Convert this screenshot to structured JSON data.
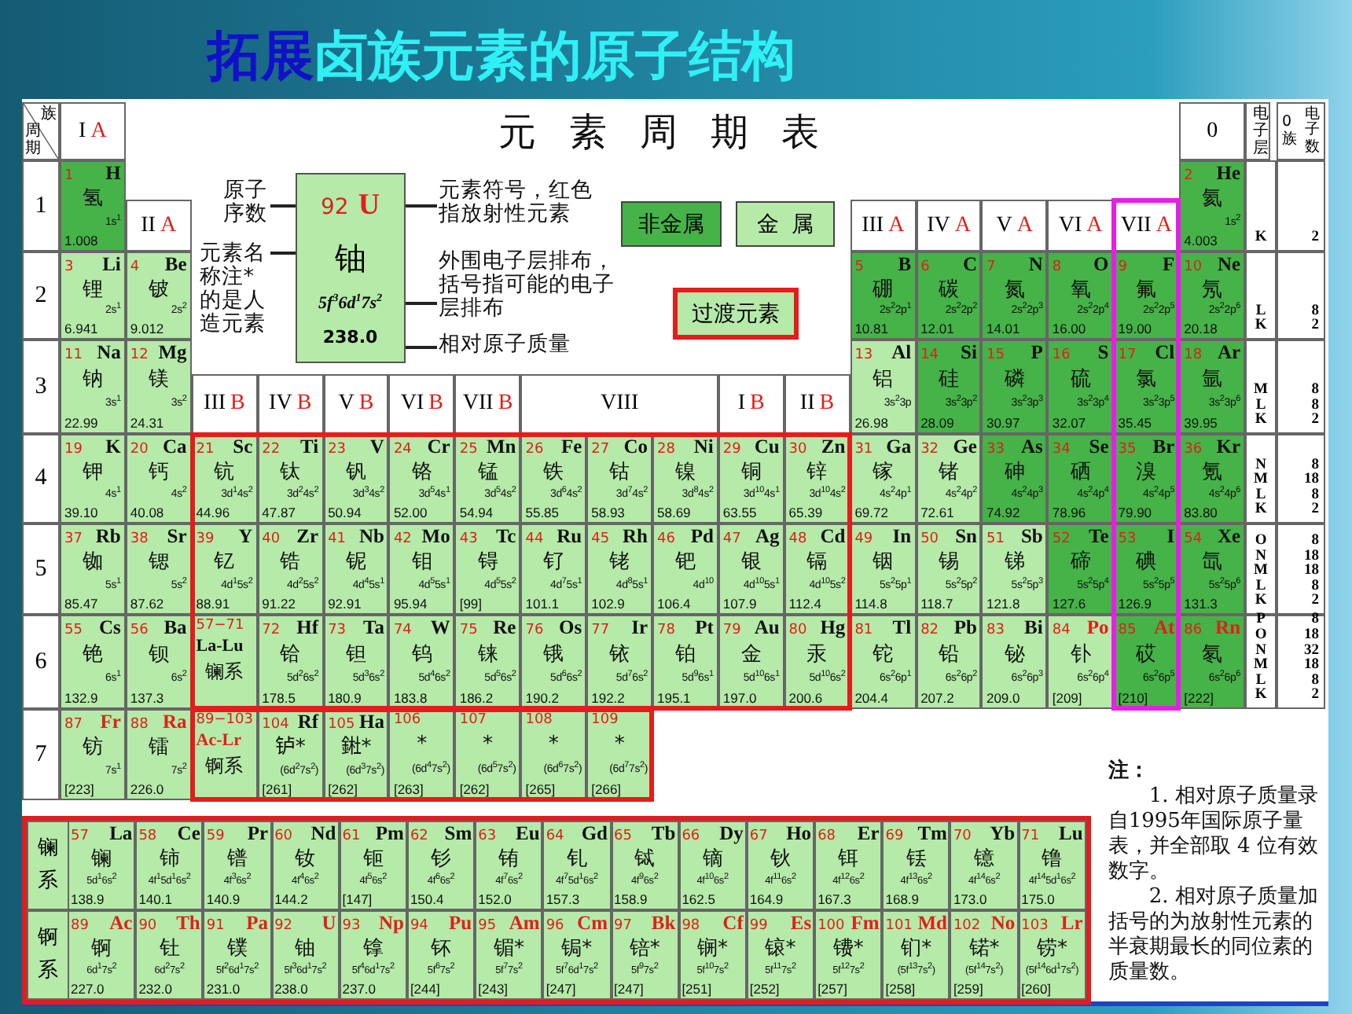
{
  "slide_title": {
    "lead": "拓展",
    "text": "卤族元素的原子结构"
  },
  "table_title": "元素周期表",
  "corner": {
    "group_axis": "族",
    "period_axis": "周期"
  },
  "headers": {
    "ia": {
      "numeral": "I",
      "suffix": "A"
    },
    "zero": {
      "numeral": "0"
    },
    "iia": {
      "numeral": "II",
      "suffix": "A"
    },
    "a_groups": [
      {
        "numeral": "III",
        "suffix": "A"
      },
      {
        "numeral": "IV",
        "suffix": "A"
      },
      {
        "numeral": "V",
        "suffix": "A"
      },
      {
        "numeral": "VI",
        "suffix": "A"
      },
      {
        "numeral": "VII",
        "suffix": "A"
      }
    ],
    "b_groups": [
      {
        "numeral": "III",
        "suffix": "B"
      },
      {
        "numeral": "IV",
        "suffix": "B"
      },
      {
        "numeral": "V",
        "suffix": "B"
      },
      {
        "numeral": "VI",
        "suffix": "B"
      },
      {
        "numeral": "VII",
        "suffix": "B"
      },
      {
        "numeral": "VIII"
      },
      {
        "numeral": "I",
        "suffix": "B"
      },
      {
        "numeral": "II",
        "suffix": "B"
      }
    ]
  },
  "legend": {
    "atomic_number_label": "原子序数",
    "name_label": "元素名称注*的是人造元素",
    "sample": {
      "n": "92",
      "sym": "U",
      "name": "铀",
      "cfg": "5f$^{3}$6d$^{1}$7s$^{2}$",
      "mass": "238.0",
      "radioactive": true
    },
    "symbol_label": "元素符号，红色指放射性元素",
    "config_label": "外围电子层排布，括号指可能的电子层排布",
    "mass_label": "相对原子质量",
    "categories": [
      {
        "label": "非金属",
        "nonmetal": true
      },
      {
        "label": "金属",
        "nonmetal": false
      }
    ],
    "transition_label": "过渡元素"
  },
  "shells": {
    "layer_header": "电子层",
    "count_header": [
      "0族",
      "电子数"
    ],
    "rows": [
      {
        "layers": [
          "K"
        ],
        "counts": [
          "2"
        ]
      },
      {
        "layers": [
          "L",
          "K"
        ],
        "counts": [
          "8",
          "2"
        ]
      },
      {
        "layers": [
          "M",
          "L",
          "K"
        ],
        "counts": [
          "8",
          "8",
          "2"
        ]
      },
      {
        "layers": [
          "N",
          "M",
          "L",
          "K"
        ],
        "counts": [
          "8",
          "18",
          "8",
          "2"
        ]
      },
      {
        "layers": [
          "O",
          "N",
          "M",
          "L",
          "K"
        ],
        "counts": [
          "8",
          "18",
          "18",
          "8",
          "2"
        ]
      },
      {
        "layers": [
          "P",
          "O",
          "N",
          "M",
          "L",
          "K"
        ],
        "counts": [
          "8",
          "18",
          "32",
          "18",
          "8",
          "2"
        ]
      }
    ]
  },
  "periods": [
    {
      "label": "1",
      "cells": [
        {
          "kind": "element",
          "n": "1",
          "sym": "H",
          "name": "氢",
          "cfg": "1s$^{1}$",
          "mass": "1.008",
          "nonmetal": true,
          "radioactive": false
        },
        {
          "kind": "element",
          "n": "2",
          "sym": "He",
          "name": "氦",
          "cfg": "1s$^{2}$",
          "mass": "4.003",
          "nonmetal": true,
          "radioactive": false
        }
      ]
    },
    {
      "label": "2",
      "cells": [
        {
          "kind": "element",
          "n": "3",
          "sym": "Li",
          "name": "锂",
          "cfg": "2s$^{1}$",
          "mass": "6.941",
          "nonmetal": false,
          "radioactive": false
        },
        {
          "kind": "element",
          "n": "4",
          "sym": "Be",
          "name": "铍",
          "cfg": "2s$^{2}$",
          "mass": "9.012",
          "nonmetal": false,
          "radioactive": false
        },
        {
          "kind": "element",
          "n": "5",
          "sym": "B",
          "name": "硼",
          "cfg": "2s$^{2}$2p$^{1}$",
          "mass": "10.81",
          "nonmetal": true,
          "radioactive": false
        },
        {
          "kind": "element",
          "n": "6",
          "sym": "C",
          "name": "碳",
          "cfg": "2s$^{2}$2p$^{2}$",
          "mass": "12.01",
          "nonmetal": true,
          "radioactive": false
        },
        {
          "kind": "element",
          "n": "7",
          "sym": "N",
          "name": "氮",
          "cfg": "2s$^{2}$2p$^{3}$",
          "mass": "14.01",
          "nonmetal": true,
          "radioactive": false
        },
        {
          "kind": "element",
          "n": "8",
          "sym": "O",
          "name": "氧",
          "cfg": "2s$^{2}$2p$^{4}$",
          "mass": "16.00",
          "nonmetal": true,
          "radioactive": false
        },
        {
          "kind": "element",
          "n": "9",
          "sym": "F",
          "name": "氟",
          "cfg": "2s$^{2}$2p$^{5}$",
          "mass": "19.00",
          "nonmetal": true,
          "radioactive": false
        },
        {
          "kind": "element",
          "n": "10",
          "sym": "Ne",
          "name": "氖",
          "cfg": "2s$^{2}$2p$^{6}$",
          "mass": "20.18",
          "nonmetal": true,
          "radioactive": false
        }
      ]
    },
    {
      "label": "3",
      "cells": [
        {
          "kind": "element",
          "n": "11",
          "sym": "Na",
          "name": "钠",
          "cfg": "3s$^{1}$",
          "mass": "22.99",
          "nonmetal": false,
          "radioactive": false
        },
        {
          "kind": "element",
          "n": "12",
          "sym": "Mg",
          "name": "镁",
          "cfg": "3s$^{2}$",
          "mass": "24.31",
          "nonmetal": false,
          "radioactive": false
        },
        {
          "kind": "element",
          "n": "13",
          "sym": "Al",
          "name": "铝",
          "cfg": "3s$^{2}$3p",
          "mass": "26.98",
          "nonmetal": false,
          "radioactive": false
        },
        {
          "kind": "element",
          "n": "14",
          "sym": "Si",
          "name": "硅",
          "cfg": "3s$^{2}$3p$^{2}$",
          "mass": "28.09",
          "nonmetal": true,
          "radioactive": false
        },
        {
          "kind": "element",
          "n": "15",
          "sym": "P",
          "name": "磷",
          "cfg": "3s$^{2}$3p$^{3}$",
          "mass": "30.97",
          "nonmetal": true,
          "radioactive": false
        },
        {
          "kind": "element",
          "n": "16",
          "sym": "S",
          "name": "硫",
          "cfg": "3s$^{2}$3p$^{4}$",
          "mass": "32.07",
          "nonmetal": true,
          "radioactive": false
        },
        {
          "kind": "element",
          "n": "17",
          "sym": "Cl",
          "name": "氯",
          "cfg": "3s$^{2}$3p$^{5}$",
          "mass": "35.45",
          "nonmetal": true,
          "radioactive": false
        },
        {
          "kind": "element",
          "n": "18",
          "sym": "Ar",
          "name": "氩",
          "cfg": "3s$^{2}$3p$^{6}$",
          "mass": "39.95",
          "nonmetal": true,
          "radioactive": false
        }
      ]
    },
    {
      "label": "4",
      "cells": [
        {
          "kind": "element",
          "n": "19",
          "sym": "K",
          "name": "钾",
          "cfg": "4s$^{1}$",
          "mass": "39.10",
          "nonmetal": false,
          "radioactive": false
        },
        {
          "kind": "element",
          "n": "20",
          "sym": "Ca",
          "name": "钙",
          "cfg": "4s$^{2}$",
          "mass": "40.08",
          "nonmetal": false,
          "radioactive": false
        },
        {
          "kind": "element",
          "n": "21",
          "sym": "Sc",
          "name": "钪",
          "cfg": "3d$^{1}$4s$^{2}$",
          "mass": "44.96",
          "nonmetal": false,
          "radioactive": false
        },
        {
          "kind": "element",
          "n": "22",
          "sym": "Ti",
          "name": "钛",
          "cfg": "3d$^{2}$4s$^{2}$",
          "mass": "47.87",
          "nonmetal": false,
          "radioactive": false
        },
        {
          "kind": "element",
          "n": "23",
          "sym": "V",
          "name": "钒",
          "cfg": "3d$^{3}$4s$^{2}$",
          "mass": "50.94",
          "nonmetal": false,
          "radioactive": false
        },
        {
          "kind": "element",
          "n": "24",
          "sym": "Cr",
          "name": "铬",
          "cfg": "3d$^{5}$4s$^{1}$",
          "mass": "52.00",
          "nonmetal": false,
          "radioactive": false
        },
        {
          "kind": "element",
          "n": "25",
          "sym": "Mn",
          "name": "锰",
          "cfg": "3d$^{5}$4s$^{2}$",
          "mass": "54.94",
          "nonmetal": false,
          "radioactive": false
        },
        {
          "kind": "element",
          "n": "26",
          "sym": "Fe",
          "name": "铁",
          "cfg": "3d$^{6}$4s$^{2}$",
          "mass": "55.85",
          "nonmetal": false,
          "radioactive": false
        },
        {
          "kind": "element",
          "n": "27",
          "sym": "Co",
          "name": "钴",
          "cfg": "3d$^{7}$4s$^{2}$",
          "mass": "58.93",
          "nonmetal": false,
          "radioactive": false
        },
        {
          "kind": "element",
          "n": "28",
          "sym": "Ni",
          "name": "镍",
          "cfg": "3d$^{8}$4s$^{2}$",
          "mass": "58.69",
          "nonmetal": false,
          "radioactive": false
        },
        {
          "kind": "element",
          "n": "29",
          "sym": "Cu",
          "name": "铜",
          "cfg": "3d$^{10}$4s$^{1}$",
          "mass": "63.55",
          "nonmetal": false,
          "radioactive": false
        },
        {
          "kind": "element",
          "n": "30",
          "sym": "Zn",
          "name": "锌",
          "cfg": "3d$^{10}$4s$^{2}$",
          "mass": "65.39",
          "nonmetal": false,
          "radioactive": false
        },
        {
          "kind": "element",
          "n": "31",
          "sym": "Ga",
          "name": "镓",
          "cfg": "4s$^{2}$4p$^{1}$",
          "mass": "69.72",
          "nonmetal": false,
          "radioactive": false
        },
        {
          "kind": "element",
          "n": "32",
          "sym": "Ge",
          "name": "锗",
          "cfg": "4s$^{2}$4p$^{2}$",
          "mass": "72.61",
          "nonmetal": false,
          "radioactive": false
        },
        {
          "kind": "element",
          "n": "33",
          "sym": "As",
          "name": "砷",
          "cfg": "4s$^{2}$4p$^{3}$",
          "mass": "74.92",
          "nonmetal": true,
          "radioactive": false
        },
        {
          "kind": "element",
          "n": "34",
          "sym": "Se",
          "name": "硒",
          "cfg": "4s$^{2}$4p$^{4}$",
          "mass": "78.96",
          "nonmetal": true,
          "radioactive": false
        },
        {
          "kind": "element",
          "n": "35",
          "sym": "Br",
          "name": "溴",
          "cfg": "4s$^{2}$4p$^{5}$",
          "mass": "79.90",
          "nonmetal": true,
          "radioactive": false
        },
        {
          "kind": "element",
          "n": "36",
          "sym": "Kr",
          "name": "氪",
          "cfg": "4s$^{2}$4p$^{6}$",
          "mass": "83.80",
          "nonmetal": true,
          "radioactive": false
        }
      ]
    },
    {
      "label": "5",
      "cells": [
        {
          "kind": "element",
          "n": "37",
          "sym": "Rb",
          "name": "铷",
          "cfg": "5s$^{1}$",
          "mass": "85.47",
          "nonmetal": false,
          "radioactive": false
        },
        {
          "kind": "element",
          "n": "38",
          "sym": "Sr",
          "name": "锶",
          "cfg": "5s$^{2}$",
          "mass": "87.62",
          "nonmetal": false,
          "radioactive": false
        },
        {
          "kind": "element",
          "n": "39",
          "sym": "Y",
          "name": "钇",
          "cfg": "4d$^{1}$5s$^{2}$",
          "mass": "88.91",
          "nonmetal": false,
          "radioactive": false
        },
        {
          "kind": "element",
          "n": "40",
          "sym": "Zr",
          "name": "锆",
          "cfg": "4d$^{2}$5s$^{2}$",
          "mass": "91.22",
          "nonmetal": false,
          "radioactive": false
        },
        {
          "kind": "element",
          "n": "41",
          "sym": "Nb",
          "name": "铌",
          "cfg": "4d$^{4}$5s$^{1}$",
          "mass": "92.91",
          "nonmetal": false,
          "radioactive": false
        },
        {
          "kind": "element",
          "n": "42",
          "sym": "Mo",
          "name": "钼",
          "cfg": "4d$^{5}$5s$^{1}$",
          "mass": "95.94",
          "nonmetal": false,
          "radioactive": false
        },
        {
          "kind": "element",
          "n": "43",
          "sym": "Tc",
          "name": "锝",
          "cfg": "4d$^{5}$5s$^{2}$",
          "mass": "[99]",
          "nonmetal": false,
          "radioactive": false
        },
        {
          "kind": "element",
          "n": "44",
          "sym": "Ru",
          "name": "钌",
          "cfg": "4d$^{7}$5s$^{1}$",
          "mass": "101.1",
          "nonmetal": false,
          "radioactive": false
        },
        {
          "kind": "element",
          "n": "45",
          "sym": "Rh",
          "name": "铑",
          "cfg": "4d$^{8}$5s$^{1}$",
          "mass": "102.9",
          "nonmetal": false,
          "radioactive": false
        },
        {
          "kind": "element",
          "n": "46",
          "sym": "Pd",
          "name": "钯",
          "cfg": "4d$^{10}$",
          "mass": "106.4",
          "nonmetal": false,
          "radioactive": false
        },
        {
          "kind": "element",
          "n": "47",
          "sym": "Ag",
          "name": "银",
          "cfg": "4d$^{10}$5s$^{1}$",
          "mass": "107.9",
          "nonmetal": false,
          "radioactive": false
        },
        {
          "kind": "element",
          "n": "48",
          "sym": "Cd",
          "name": "镉",
          "cfg": "4d$^{10}$5s$^{2}$",
          "mass": "112.4",
          "nonmetal": false,
          "radioactive": false
        },
        {
          "kind": "element",
          "n": "49",
          "sym": "In",
          "name": "铟",
          "cfg": "5s$^{2}$5p$^{1}$",
          "mass": "114.8",
          "nonmetal": false,
          "radioactive": false
        },
        {
          "kind": "element",
          "n": "50",
          "sym": "Sn",
          "name": "锡",
          "cfg": "5s$^{2}$5p$^{2}$",
          "mass": "118.7",
          "nonmetal": false,
          "radioactive": false
        },
        {
          "kind": "element",
          "n": "51",
          "sym": "Sb",
          "name": "锑",
          "cfg": "5s$^{2}$5p$^{3}$",
          "mass": "121.8",
          "nonmetal": false,
          "radioactive": false
        },
        {
          "kind": "element",
          "n": "52",
          "sym": "Te",
          "name": "碲",
          "cfg": "5s$^{2}$5p$^{4}$",
          "mass": "127.6",
          "nonmetal": true,
          "radioactive": false
        },
        {
          "kind": "element",
          "n": "53",
          "sym": "I",
          "name": "碘",
          "cfg": "5s$^{2}$5p$^{5}$",
          "mass": "126.9",
          "nonmetal": true,
          "radioactive": false
        },
        {
          "kind": "element",
          "n": "54",
          "sym": "Xe",
          "name": "氙",
          "cfg": "5s$^{2}$5p$^{6}$",
          "mass": "131.3",
          "nonmetal": true,
          "radioactive": false
        }
      ]
    },
    {
      "label": "6",
      "cells": [
        {
          "kind": "element",
          "n": "55",
          "sym": "Cs",
          "name": "铯",
          "cfg": "6s$^{1}$",
          "mass": "132.9",
          "nonmetal": false,
          "radioactive": false
        },
        {
          "kind": "element",
          "n": "56",
          "sym": "Ba",
          "name": "钡",
          "cfg": "6s$^{2}$",
          "mass": "137.3",
          "nonmetal": false,
          "radioactive": false
        },
        {
          "kind": "series",
          "n": "57−71",
          "sym": "La-Lu",
          "name": "镧系",
          "nonmetal": false,
          "radioactive": false
        },
        {
          "kind": "element",
          "n": "72",
          "sym": "Hf",
          "name": "铪",
          "cfg": "5d$^{2}$6s$^{2}$",
          "mass": "178.5",
          "nonmetal": false,
          "radioactive": false
        },
        {
          "kind": "element",
          "n": "73",
          "sym": "Ta",
          "name": "钽",
          "cfg": "5d$^{3}$6s$^{2}$",
          "mass": "180.9",
          "nonmetal": false,
          "radioactive": false
        },
        {
          "kind": "element",
          "n": "74",
          "sym": "W",
          "name": "钨",
          "cfg": "5d$^{4}$6s$^{2}$",
          "mass": "183.8",
          "nonmetal": false,
          "radioactive": false
        },
        {
          "kind": "element",
          "n": "75",
          "sym": "Re",
          "name": "铼",
          "cfg": "5d$^{5}$6s$^{2}$",
          "mass": "186.2",
          "nonmetal": false,
          "radioactive": false
        },
        {
          "kind": "element",
          "n": "76",
          "sym": "Os",
          "name": "锇",
          "cfg": "5d$^{6}$6s$^{2}$",
          "mass": "190.2",
          "nonmetal": false,
          "radioactive": false
        },
        {
          "kind": "element",
          "n": "77",
          "sym": "Ir",
          "name": "铱",
          "cfg": "5d$^{7}$6s$^{2}$",
          "mass": "192.2",
          "nonmetal": false,
          "radioactive": false
        },
        {
          "kind": "element",
          "n": "78",
          "sym": "Pt",
          "name": "铂",
          "cfg": "5d$^{9}$6s$^{1}$",
          "mass": "195.1",
          "nonmetal": false,
          "radioactive": false
        },
        {
          "kind": "element",
          "n": "79",
          "sym": "Au",
          "name": "金",
          "cfg": "5d$^{10}$6s$^{1}$",
          "mass": "197.0",
          "nonmetal": false,
          "radioactive": false
        },
        {
          "kind": "element",
          "n": "80",
          "sym": "Hg",
          "name": "汞",
          "cfg": "5d$^{10}$6s$^{2}$",
          "mass": "200.6",
          "nonmetal": false,
          "radioactive": false
        },
        {
          "kind": "element",
          "n": "81",
          "sym": "Tl",
          "name": "铊",
          "cfg": "6s$^{2}$6p$^{1}$",
          "mass": "204.4",
          "nonmetal": false,
          "radioactive": false
        },
        {
          "kind": "element",
          "n": "82",
          "sym": "Pb",
          "name": "铅",
          "cfg": "6s$^{2}$6p$^{2}$",
          "mass": "207.2",
          "nonmetal": false,
          "radioactive": false
        },
        {
          "kind": "element",
          "n": "83",
          "sym": "Bi",
          "name": "铋",
          "cfg": "6s$^{2}$6p$^{3}$",
          "mass": "209.0",
          "nonmetal": false,
          "radioactive": false
        },
        {
          "kind": "element",
          "n": "84",
          "sym": "Po",
          "name": "钋",
          "cfg": "6s$^{2}$6p$^{4}$",
          "mass": "[209]",
          "nonmetal": false,
          "radioactive": true
        },
        {
          "kind": "element",
          "n": "85",
          "sym": "At",
          "name": "砹",
          "cfg": "6s$^{2}$6p$^{5}$",
          "mass": "[210]",
          "nonmetal": true,
          "radioactive": true
        },
        {
          "kind": "element",
          "n": "86",
          "sym": "Rn",
          "name": "氡",
          "cfg": "6s$^{2}$6p$^{6}$",
          "mass": "[222]",
          "nonmetal": true,
          "radioactive": true
        }
      ]
    },
    {
      "label": "7",
      "cells": [
        {
          "kind": "element",
          "n": "87",
          "sym": "Fr",
          "name": "钫",
          "cfg": "7s$^{1}$",
          "mass": "[223]",
          "nonmetal": false,
          "radioactive": true
        },
        {
          "kind": "element",
          "n": "88",
          "sym": "Ra",
          "name": "镭",
          "cfg": "7s$^{2}$",
          "mass": "226.0",
          "nonmetal": false,
          "radioactive": true
        },
        {
          "kind": "series",
          "n": "89−103",
          "sym": "Ac-Lr",
          "name": "锕系",
          "nonmetal": false,
          "radioactive": true
        },
        {
          "kind": "element",
          "n": "104",
          "sym": "Rf",
          "name": "𬬻*",
          "cfg": "(6d$^{2}$7s$^{2}$)",
          "mass": "[261]",
          "nonmetal": false,
          "radioactive": false
        },
        {
          "kind": "element",
          "n": "105",
          "sym": "Ha",
          "name": "𨧀*",
          "cfg": "(6d$^{3}$7s$^{2}$)",
          "mass": "[262]",
          "nonmetal": false,
          "radioactive": false
        },
        {
          "kind": "element",
          "n": "106",
          "name": "*",
          "cfg": "(6d$^{4}$7s$^{2}$)",
          "mass": "[263]",
          "nonmetal": false
        },
        {
          "kind": "element",
          "n": "107",
          "name": "*",
          "cfg": "(6d$^{5}$7s$^{2}$)",
          "mass": "[262]",
          "nonmetal": false
        },
        {
          "kind": "element",
          "n": "108",
          "name": "*",
          "cfg": "(6d$^{6}$7s$^{2}$)",
          "mass": "[265]",
          "nonmetal": false
        },
        {
          "kind": "element",
          "n": "109",
          "name": "*",
          "cfg": "(6d$^{7}$7s$^{2}$)",
          "mass": "[266]",
          "nonmetal": false
        }
      ]
    }
  ],
  "lanthanides": {
    "label": "镧系",
    "cells": [
      {
        "kind": "element",
        "n": "57",
        "sym": "La",
        "name": "镧",
        "cfg": "5d$^{1}$6s$^{2}$",
        "mass": "138.9",
        "nonmetal": false,
        "radioactive": false
      },
      {
        "kind": "element",
        "n": "58",
        "sym": "Ce",
        "name": "铈",
        "cfg": "4f$^{1}$5d$^{1}$6s$^{2}$",
        "mass": "140.1",
        "nonmetal": false,
        "radioactive": false
      },
      {
        "kind": "element",
        "n": "59",
        "sym": "Pr",
        "name": "镨",
        "cfg": "4f$^{3}$6s$^{2}$",
        "mass": "140.9",
        "nonmetal": false,
        "radioactive": false
      },
      {
        "kind": "element",
        "n": "60",
        "sym": "Nd",
        "name": "钕",
        "cfg": "4f$^{4}$6s$^{2}$",
        "mass": "144.2",
        "nonmetal": false,
        "radioactive": false
      },
      {
        "kind": "element",
        "n": "61",
        "sym": "Pm",
        "name": "钷",
        "cfg": "4f$^{5}$6s$^{2}$",
        "mass": "[147]",
        "nonmetal": false,
        "radioactive": false
      },
      {
        "kind": "element",
        "n": "62",
        "sym": "Sm",
        "name": "钐",
        "cfg": "4f$^{6}$6s$^{2}$",
        "mass": "150.4",
        "nonmetal": false,
        "radioactive": false
      },
      {
        "kind": "element",
        "n": "63",
        "sym": "Eu",
        "name": "铕",
        "cfg": "4f$^{7}$6s$^{2}$",
        "mass": "152.0",
        "nonmetal": false,
        "radioactive": false
      },
      {
        "kind": "element",
        "n": "64",
        "sym": "Gd",
        "name": "钆",
        "cfg": "4f$^{7}$5d$^{1}$6s$^{2}$",
        "mass": "157.3",
        "nonmetal": false,
        "radioactive": false
      },
      {
        "kind": "element",
        "n": "65",
        "sym": "Tb",
        "name": "铽",
        "cfg": "4f$^{9}$6s$^{2}$",
        "mass": "158.9",
        "nonmetal": false,
        "radioactive": false
      },
      {
        "kind": "element",
        "n": "66",
        "sym": "Dy",
        "name": "镝",
        "cfg": "4f$^{10}$6s$^{2}$",
        "mass": "162.5",
        "nonmetal": false,
        "radioactive": false
      },
      {
        "kind": "element",
        "n": "67",
        "sym": "Ho",
        "name": "钬",
        "cfg": "4f$^{11}$6s$^{2}$",
        "mass": "164.9",
        "nonmetal": false,
        "radioactive": false
      },
      {
        "kind": "element",
        "n": "68",
        "sym": "Er",
        "name": "铒",
        "cfg": "4f$^{12}$6s$^{2}$",
        "mass": "167.3",
        "nonmetal": false,
        "radioactive": false
      },
      {
        "kind": "element",
        "n": "69",
        "sym": "Tm",
        "name": "铥",
        "cfg": "4f$^{13}$6s$^{2}$",
        "mass": "168.9",
        "nonmetal": false,
        "radioactive": false
      },
      {
        "kind": "element",
        "n": "70",
        "sym": "Yb",
        "name": "镱",
        "cfg": "4f$^{14}$6s$^{2}$",
        "mass": "173.0",
        "nonmetal": false,
        "radioactive": false
      },
      {
        "kind": "element",
        "n": "71",
        "sym": "Lu",
        "name": "镥",
        "cfg": "4f$^{14}$5d$^{1}$6s$^{2}$",
        "mass": "175.0",
        "nonmetal": false,
        "radioactive": false
      }
    ]
  },
  "actinides": {
    "label": "锕系",
    "cells": [
      {
        "kind": "element",
        "n": "89",
        "sym": "Ac",
        "name": "锕",
        "cfg": "6d$^{1}$7s$^{2}$",
        "mass": "227.0",
        "nonmetal": false,
        "radioactive": true
      },
      {
        "kind": "element",
        "n": "90",
        "sym": "Th",
        "name": "钍",
        "cfg": "6d$^{2}$7s$^{2}$",
        "mass": "232.0",
        "nonmetal": false,
        "radioactive": true
      },
      {
        "kind": "element",
        "n": "91",
        "sym": "Pa",
        "name": "镤",
        "cfg": "5f$^{2}$6d$^{1}$7s$^{2}$",
        "mass": "231.0",
        "nonmetal": false,
        "radioactive": true
      },
      {
        "kind": "element",
        "n": "92",
        "sym": "U",
        "name": "铀",
        "cfg": "5f$^{3}$6d$^{1}$7s$^{2}$",
        "mass": "238.0",
        "nonmetal": false,
        "radioactive": true
      },
      {
        "kind": "element",
        "n": "93",
        "sym": "Np",
        "name": "镎",
        "cfg": "5f$^{4}$6d$^{1}$7s$^{2}$",
        "mass": "237.0",
        "nonmetal": false,
        "radioactive": true
      },
      {
        "kind": "element",
        "n": "94",
        "sym": "Pu",
        "name": "钚",
        "cfg": "5f$^{6}$7s$^{2}$",
        "mass": "[244]",
        "nonmetal": false,
        "radioactive": true
      },
      {
        "kind": "element",
        "n": "95",
        "sym": "Am",
        "name": "镅*",
        "cfg": "5f$^{7}$7s$^{2}$",
        "mass": "[243]",
        "nonmetal": false,
        "radioactive": true
      },
      {
        "kind": "element",
        "n": "96",
        "sym": "Cm",
        "name": "锔*",
        "cfg": "5f$^{7}$6d$^{1}$7s$^{2}$",
        "mass": "[247]",
        "nonmetal": false,
        "radioactive": true
      },
      {
        "kind": "element",
        "n": "97",
        "sym": "Bk",
        "name": "锫*",
        "cfg": "5f$^{9}$7s$^{2}$",
        "mass": "[247]",
        "nonmetal": false,
        "radioactive": true
      },
      {
        "kind": "element",
        "n": "98",
        "sym": "Cf",
        "name": "锎*",
        "cfg": "5f$^{10}$7s$^{2}$",
        "mass": "[251]",
        "nonmetal": false,
        "radioactive": true
      },
      {
        "kind": "element",
        "n": "99",
        "sym": "Es",
        "name": "锿*",
        "cfg": "5f$^{11}$7s$^{2}$",
        "mass": "[252]",
        "nonmetal": false,
        "radioactive": true
      },
      {
        "kind": "element",
        "n": "100",
        "sym": "Fm",
        "name": "镄*",
        "cfg": "5f$^{12}$7s$^{2}$",
        "mass": "[257]",
        "nonmetal": false,
        "radioactive": true
      },
      {
        "kind": "element",
        "n": "101",
        "sym": "Md",
        "name": "钔*",
        "cfg": "(5f$^{13}$7s$^{2}$)",
        "mass": "[258]",
        "nonmetal": false,
        "radioactive": true
      },
      {
        "kind": "element",
        "n": "102",
        "sym": "No",
        "name": "锘*",
        "cfg": "(5f$^{14}$7s$^{2}$)",
        "mass": "[259]",
        "nonmetal": false,
        "radioactive": true
      },
      {
        "kind": "element",
        "n": "103",
        "sym": "Lr",
        "name": "铹*",
        "cfg": "(5f$^{14}$6d$^{1}$7s$^{2}$)",
        "mass": "[260]",
        "nonmetal": false,
        "radioactive": true
      }
    ]
  },
  "notes": {
    "heading": "注：",
    "items": [
      "1. 相对原子质量录自1995年国际原子量表，并全部取 4 位有效数字。",
      "2. 相对原子质量加括号的为放射性元素的半衰期最长的同位素的质量数。"
    ]
  }
}
